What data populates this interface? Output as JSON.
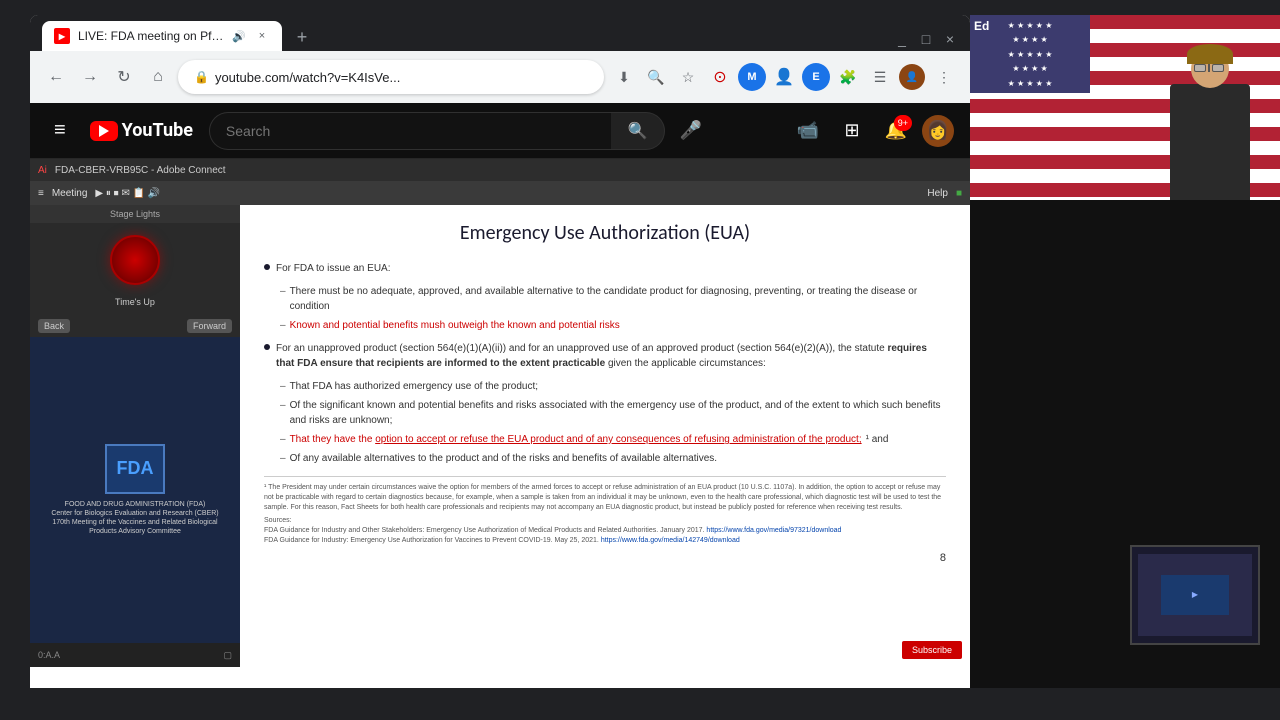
{
  "browser": {
    "tab": {
      "favicon_text": "▶",
      "title": "LIVE: FDA meeting on Pfizer",
      "sound_icon": "🔊",
      "close_label": "×"
    },
    "new_tab_label": "+",
    "address": "youtube.com/watch?v=K4IsVe...",
    "nav": {
      "back": "←",
      "forward": "→",
      "refresh": "↻",
      "home": "⌂"
    },
    "window_controls": {
      "minimize": "_",
      "maximize": "□",
      "close": "×"
    }
  },
  "youtube": {
    "header": {
      "menu_icon": "≡",
      "logo_text": "YouTube",
      "search_placeholder": "Search",
      "mic_icon": "🎤",
      "create_icon": "📹",
      "apps_icon": "⊞",
      "notification_count": "9+",
      "avatar_text": ""
    },
    "video": {
      "meeting": {
        "topbar_text": "FDA-CBER-VRB95C - Adobe Connect",
        "toolbar": {
          "meeting": "Meeting",
          "help": "Help"
        },
        "left_panel": {
          "stage_lights": "Stage Lights",
          "timer_label": "Time's Up",
          "btn1": "Back",
          "btn2": "Forward",
          "fda_text": "FDA",
          "fda_description": "FOOD AND DRUG ADMINISTRATION (FDA)\nCenter for Biologics Evaluation and Research (CBER)\n170th Meeting of the Vaccines and Related Biological\nProducts Advisory Committee",
          "footer_text": "0:A.A"
        },
        "slide": {
          "title": "Emergency Use Authorization (EUA)",
          "bullet1": "For FDA to issue an EUA:",
          "sub1a": "There must be no adequate, approved, and available alternative to the candidate product for diagnosing, preventing, or treating the disease or condition",
          "sub1b_red": "Known and potential benefits mush outweigh the known and potential risks",
          "bullet2": "For an unapproved product (section 564(e)(1)(A)(ii)) and for an unapproved use of an approved product (section 564(e)(2)(A)), the statute",
          "bullet2b": "requires that FDA ensure that recipients are informed to the extent practicable",
          "bullet2c": "given the applicable circumstances:",
          "sub2a": "That FDA has authorized emergency use of the product;",
          "sub2b": "Of the significant known and potential benefits and risks associated with the emergency use of the product, and of the extent to which such benefits and risks are unknown;",
          "sub2c_red": "That they have the option to accept or refuse the EUA product and of any consequences of refusing administration of the product;",
          "sub2c_suffix": "¹ and",
          "sub2d": "Of any available alternatives to the product and of the risks and benefits of available alternatives.",
          "page_num": "8",
          "footnote1": "¹ The President may under certain circumstances waive the option for members of the armed forces to accept or refuse administration of an EUA product (10 U.S.C. 1107a). In addition, the option to accept or refuse may not be practicable with regard to certain diagnostics because, for example, when a sample is taken from an individual it may be unknown, even to the health care professional, which diagnostic test will be used to test the sample. For this reason, Fact Sheets for both health care professionals and recipients may not accompany an EUA diagnostic product, but instead be publicly posted for reference when receiving test results.",
          "footnote_sources": "Sources:\nFDA Guidance for Industry and Other Stakeholders: Emergency Use Authorization of Medical Products and Related Authorities. January 2017.\nFDA Guidance for Industry: Emergency Use Authorization for Vaccines to Prevent COVID-19. May 25, 2021.",
          "link1": "https://www.fda.gov/media/97321/download",
          "link2": "https://www.fda.gov/media/142749/download"
        },
        "subscribe_btn": "Subscribe"
      }
    }
  },
  "right_panel": {
    "ed_label": "Ed"
  }
}
